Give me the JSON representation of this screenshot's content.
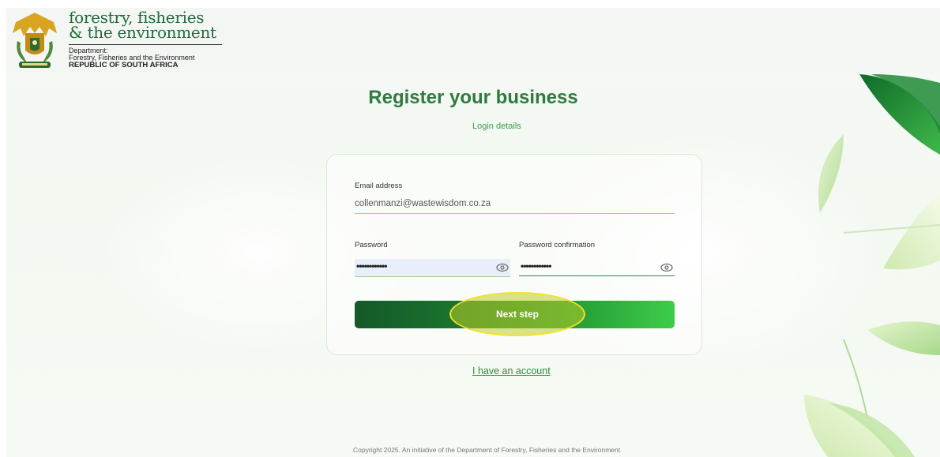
{
  "header": {
    "brand_line1": "forestry, fisheries",
    "brand_line2": "& the environment",
    "dept_line1": "Department:",
    "dept_line2": "Forestry, Fisheries and the Environment",
    "dept_line3": "REPUBLIC OF SOUTH AFRICA",
    "logo_icon": "coat-of-arms-icon"
  },
  "form": {
    "title": "Register your business",
    "subtitle": "Login details",
    "email_label": "Email address",
    "email_value": "collenmanzi@wastewisdom.co.za",
    "password_label": "Password",
    "password_value": "••••••••••••",
    "password_confirm_label": "Password confirmation",
    "password_confirm_value": "••••••••••••",
    "show_password_icon": "eye-icon",
    "next_label": "Next step",
    "account_link": "I have an account"
  },
  "footer": {
    "copyright": "Copyright 2025. An initiative of the Department of Forestry, Fisheries and the Environment"
  },
  "colors": {
    "brand_green": "#2f7a3f",
    "button_dark": "#14592a",
    "button_light": "#3dcc4a",
    "highlight": "#f3e12a",
    "accent_line": "#9fd49a"
  }
}
